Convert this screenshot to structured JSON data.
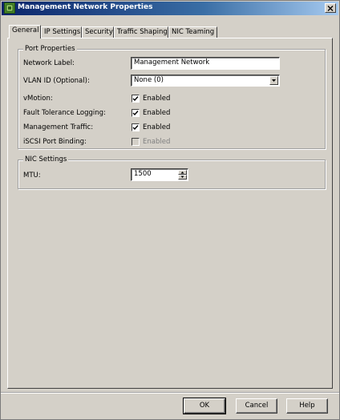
{
  "window": {
    "title": "Management Network Properties",
    "icon": "network-port-icon",
    "close_icon": "close-icon"
  },
  "tabs": [
    {
      "label": "General",
      "active": true
    },
    {
      "label": "IP Settings",
      "active": false
    },
    {
      "label": "Security",
      "active": false
    },
    {
      "label": "Traffic Shaping",
      "active": false
    },
    {
      "label": "NIC Teaming",
      "active": false
    }
  ],
  "port_properties": {
    "title": "Port Properties",
    "network_label": {
      "label": "Network Label:",
      "value": "Management Network"
    },
    "vlan_id": {
      "label": "VLAN ID (Optional):",
      "value": "None (0)"
    },
    "vmotion": {
      "label": "vMotion:",
      "checkbox_label": "Enabled",
      "checked": true,
      "enabled": true
    },
    "fault_tolerance": {
      "label": "Fault Tolerance Logging:",
      "checkbox_label": "Enabled",
      "checked": true,
      "enabled": true
    },
    "management_traffic": {
      "label": "Management Traffic:",
      "checkbox_label": "Enabled",
      "checked": true,
      "enabled": true
    },
    "iscsi_binding": {
      "label": "iSCSI Port Binding:",
      "checkbox_label": "Enabled",
      "checked": false,
      "enabled": false
    }
  },
  "nic_settings": {
    "title": "NIC Settings",
    "mtu": {
      "label": "MTU:",
      "value": "1500"
    }
  },
  "buttons": {
    "ok": "OK",
    "cancel": "Cancel",
    "help": "Help"
  },
  "colors": {
    "face": "#d4d0c8",
    "title_start": "#0a246a",
    "title_end": "#a6caf0"
  }
}
